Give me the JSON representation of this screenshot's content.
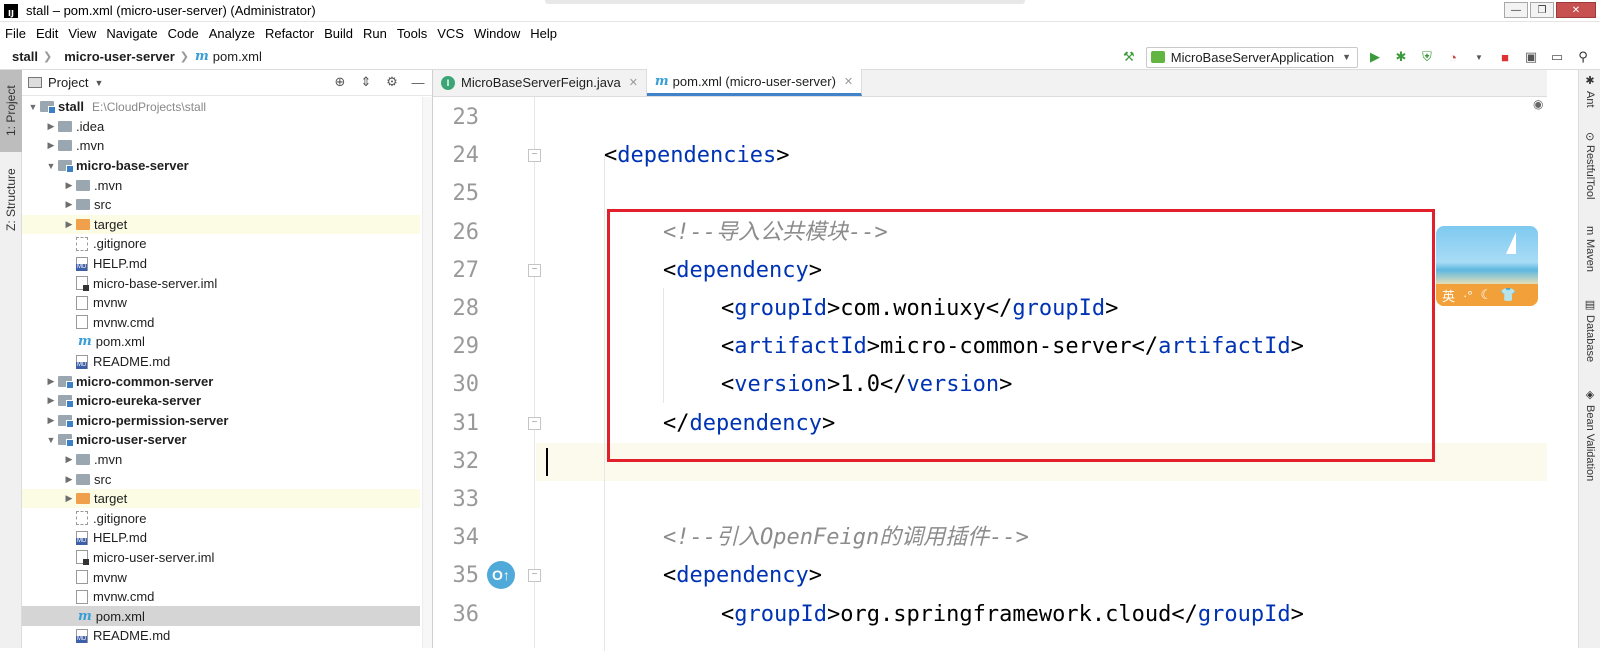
{
  "window": {
    "title": "stall – pom.xml (micro-user-server) (Administrator)",
    "controls": [
      "—",
      "❐",
      "✕"
    ]
  },
  "menu": [
    "File",
    "Edit",
    "View",
    "Navigate",
    "Code",
    "Analyze",
    "Refactor",
    "Build",
    "Run",
    "Tools",
    "VCS",
    "Window",
    "Help"
  ],
  "breadcrumb": {
    "project": "stall",
    "module": "micro-user-server",
    "file": "pom.xml"
  },
  "run_config": {
    "label": "MicroBaseServerApplication"
  },
  "left_strip": {
    "project_tab": "1: Project",
    "structure_tab": "Z: Structure"
  },
  "project_panel": {
    "title": "Project",
    "root": {
      "label": "stall",
      "path": "E:\\CloudProjects\\stall"
    },
    "items": [
      {
        "label": ".idea",
        "type": "folder",
        "depth": 1,
        "arrow": "▶",
        "bold": false,
        "state": ""
      },
      {
        "label": ".mvn",
        "type": "folder",
        "depth": 1,
        "arrow": "▶",
        "bold": false,
        "state": ""
      },
      {
        "label": "micro-base-server",
        "type": "module",
        "depth": 1,
        "arrow": "▼",
        "bold": true,
        "state": ""
      },
      {
        "label": ".mvn",
        "type": "folder",
        "depth": 2,
        "arrow": "▶",
        "bold": false,
        "state": ""
      },
      {
        "label": "src",
        "type": "folder",
        "depth": 2,
        "arrow": "▶",
        "bold": false,
        "state": ""
      },
      {
        "label": "target",
        "type": "orange",
        "depth": 2,
        "arrow": "▶",
        "bold": false,
        "state": "highlight"
      },
      {
        "label": ".gitignore",
        "type": "git",
        "depth": 2,
        "arrow": "",
        "bold": false,
        "state": ""
      },
      {
        "label": "HELP.md",
        "type": "md",
        "depth": 2,
        "arrow": "",
        "bold": false,
        "state": ""
      },
      {
        "label": "micro-base-server.iml",
        "type": "iml",
        "depth": 2,
        "arrow": "",
        "bold": false,
        "state": ""
      },
      {
        "label": "mvnw",
        "type": "file",
        "depth": 2,
        "arrow": "",
        "bold": false,
        "state": ""
      },
      {
        "label": "mvnw.cmd",
        "type": "file",
        "depth": 2,
        "arrow": "",
        "bold": false,
        "state": ""
      },
      {
        "label": "pom.xml",
        "type": "maven",
        "depth": 2,
        "arrow": "",
        "bold": false,
        "state": ""
      },
      {
        "label": "README.md",
        "type": "md",
        "depth": 2,
        "arrow": "",
        "bold": false,
        "state": ""
      },
      {
        "label": "micro-common-server",
        "type": "module",
        "depth": 1,
        "arrow": "▶",
        "bold": true,
        "state": ""
      },
      {
        "label": "micro-eureka-server",
        "type": "module",
        "depth": 1,
        "arrow": "▶",
        "bold": true,
        "state": ""
      },
      {
        "label": "micro-permission-server",
        "type": "module",
        "depth": 1,
        "arrow": "▶",
        "bold": true,
        "state": ""
      },
      {
        "label": "micro-user-server",
        "type": "module",
        "depth": 1,
        "arrow": "▼",
        "bold": true,
        "state": ""
      },
      {
        "label": ".mvn",
        "type": "folder",
        "depth": 2,
        "arrow": "▶",
        "bold": false,
        "state": ""
      },
      {
        "label": "src",
        "type": "folder",
        "depth": 2,
        "arrow": "▶",
        "bold": false,
        "state": ""
      },
      {
        "label": "target",
        "type": "orange",
        "depth": 2,
        "arrow": "▶",
        "bold": false,
        "state": "highlight"
      },
      {
        "label": ".gitignore",
        "type": "git",
        "depth": 2,
        "arrow": "",
        "bold": false,
        "state": ""
      },
      {
        "label": "HELP.md",
        "type": "md",
        "depth": 2,
        "arrow": "",
        "bold": false,
        "state": ""
      },
      {
        "label": "micro-user-server.iml",
        "type": "iml",
        "depth": 2,
        "arrow": "",
        "bold": false,
        "state": ""
      },
      {
        "label": "mvnw",
        "type": "file",
        "depth": 2,
        "arrow": "",
        "bold": false,
        "state": ""
      },
      {
        "label": "mvnw.cmd",
        "type": "file",
        "depth": 2,
        "arrow": "",
        "bold": false,
        "state": ""
      },
      {
        "label": "pom.xml",
        "type": "maven",
        "depth": 2,
        "arrow": "",
        "bold": false,
        "state": "selected"
      },
      {
        "label": "README.md",
        "type": "md",
        "depth": 2,
        "arrow": "",
        "bold": false,
        "state": ""
      }
    ]
  },
  "editor": {
    "tabs": [
      {
        "label": "MicroBaseServerFeign.java",
        "icon": "class-icon",
        "active": false
      },
      {
        "label": "pom.xml (micro-user-server)",
        "icon": "maven-icon",
        "active": true
      }
    ],
    "lines": [
      {
        "num": "23",
        "indent": 0,
        "parts": []
      },
      {
        "num": "24",
        "indent": 1,
        "parts": [
          [
            "bracket",
            "<"
          ],
          [
            "tag-name",
            "dependencies"
          ],
          [
            "bracket",
            ">"
          ]
        ]
      },
      {
        "num": "25",
        "indent": 0,
        "parts": []
      },
      {
        "num": "26",
        "indent": 2,
        "parts": [
          [
            "comment",
            "<!--导入公共模块-->"
          ]
        ]
      },
      {
        "num": "27",
        "indent": 2,
        "parts": [
          [
            "bracket",
            "<"
          ],
          [
            "tag-name",
            "dependency"
          ],
          [
            "bracket",
            ">"
          ]
        ]
      },
      {
        "num": "28",
        "indent": 3,
        "parts": [
          [
            "bracket",
            "<"
          ],
          [
            "tag-name",
            "groupId"
          ],
          [
            "bracket",
            ">com.woniuxy</"
          ],
          [
            "tag-name",
            "groupId"
          ],
          [
            "bracket",
            ">"
          ]
        ]
      },
      {
        "num": "29",
        "indent": 3,
        "parts": [
          [
            "bracket",
            "<"
          ],
          [
            "tag-name",
            "artifactId"
          ],
          [
            "bracket",
            ">micro-common-server</"
          ],
          [
            "tag-name",
            "artifactId"
          ],
          [
            "bracket",
            ">"
          ]
        ]
      },
      {
        "num": "30",
        "indent": 3,
        "parts": [
          [
            "bracket",
            "<"
          ],
          [
            "tag-name",
            "version"
          ],
          [
            "bracket",
            ">1.0</"
          ],
          [
            "tag-name",
            "version"
          ],
          [
            "bracket",
            ">"
          ]
        ]
      },
      {
        "num": "31",
        "indent": 2,
        "parts": [
          [
            "bracket",
            "</"
          ],
          [
            "tag-name",
            "dependency"
          ],
          [
            "bracket",
            ">"
          ]
        ]
      },
      {
        "num": "32",
        "indent": 0,
        "parts": [],
        "current": true
      },
      {
        "num": "33",
        "indent": 0,
        "parts": []
      },
      {
        "num": "34",
        "indent": 2,
        "parts": [
          [
            "comment",
            "<!--引入OpenFeign的调用插件-->"
          ]
        ]
      },
      {
        "num": "35",
        "indent": 2,
        "parts": [
          [
            "bracket",
            "<"
          ],
          [
            "tag-name",
            "dependency"
          ],
          [
            "bracket",
            ">"
          ]
        ]
      },
      {
        "num": "36",
        "indent": 3,
        "parts": [
          [
            "bracket",
            "<"
          ],
          [
            "tag-name",
            "groupId"
          ],
          [
            "bracket",
            ">org.springframework.cloud</"
          ],
          [
            "tag-name",
            "groupId"
          ],
          [
            "bracket",
            ">"
          ]
        ]
      }
    ]
  },
  "ime": {
    "lang": "英",
    "glyphs": [
      "·°",
      "☾",
      "👕"
    ]
  },
  "right_strip": [
    "Ant",
    "RestfulTool",
    "Maven",
    "Database",
    "Bean Validation"
  ],
  "colors": {
    "accent": "#4083c9",
    "highlight_box": "#e2202b",
    "xml_tag": "#0033b3",
    "comment": "#8c8c8c"
  }
}
